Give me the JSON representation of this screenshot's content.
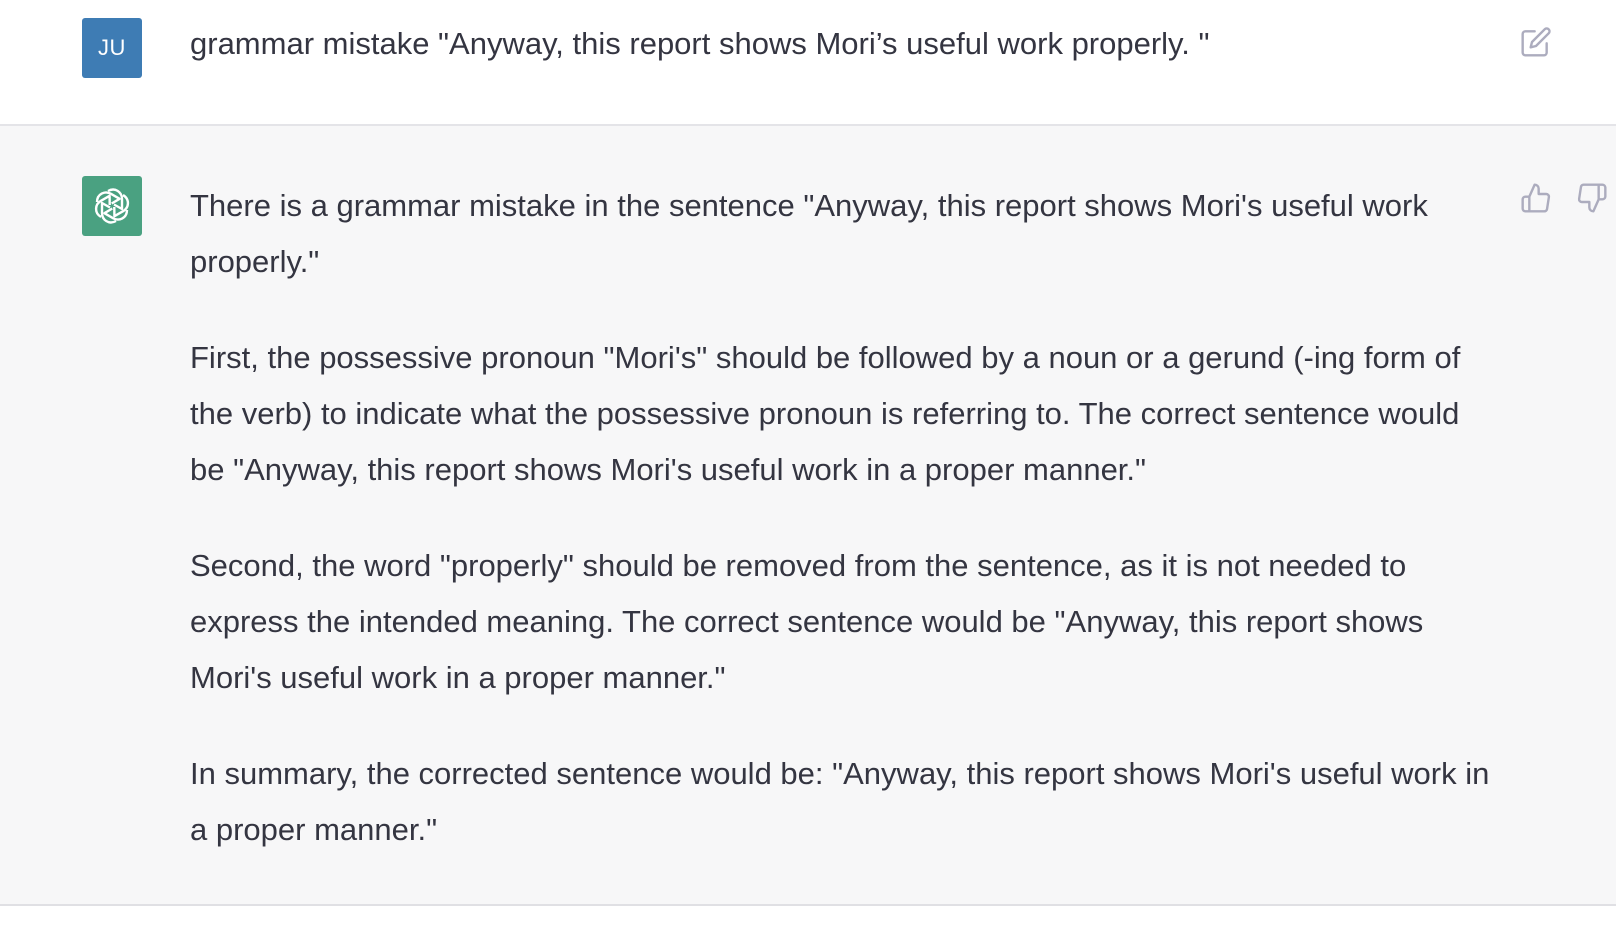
{
  "colors": {
    "user_avatar_bg": "#3e7cb4",
    "bot_avatar_bg": "#4aa181",
    "icon_gray": "#acacbe"
  },
  "user_message": {
    "avatar_initials": "JU",
    "text": "grammar mistake \"Anyway, this report shows Mori’s useful work properly. \"",
    "edit_icon": "edit-icon"
  },
  "assistant_message": {
    "avatar_icon": "openai-logo-icon",
    "paragraphs": [
      "There is a grammar mistake in the sentence \"Anyway, this report shows Mori's useful work properly.\"",
      "First, the possessive pronoun \"Mori's\" should be followed by a noun or a gerund (-ing form of the verb) to indicate what the possessive pronoun is referring to. The correct sentence would be \"Anyway, this report shows Mori's useful work in a proper manner.\"",
      "Second, the word \"properly\" should be removed from the sentence, as it is not needed to express the intended meaning. The correct sentence would be \"Anyway, this report shows Mori's useful work in a proper manner.\"",
      "In summary, the corrected sentence would be: \"Anyway, this report shows Mori's useful work in a proper manner.\""
    ],
    "feedback_icons": [
      "thumbs-up-icon",
      "thumbs-down-icon"
    ]
  }
}
